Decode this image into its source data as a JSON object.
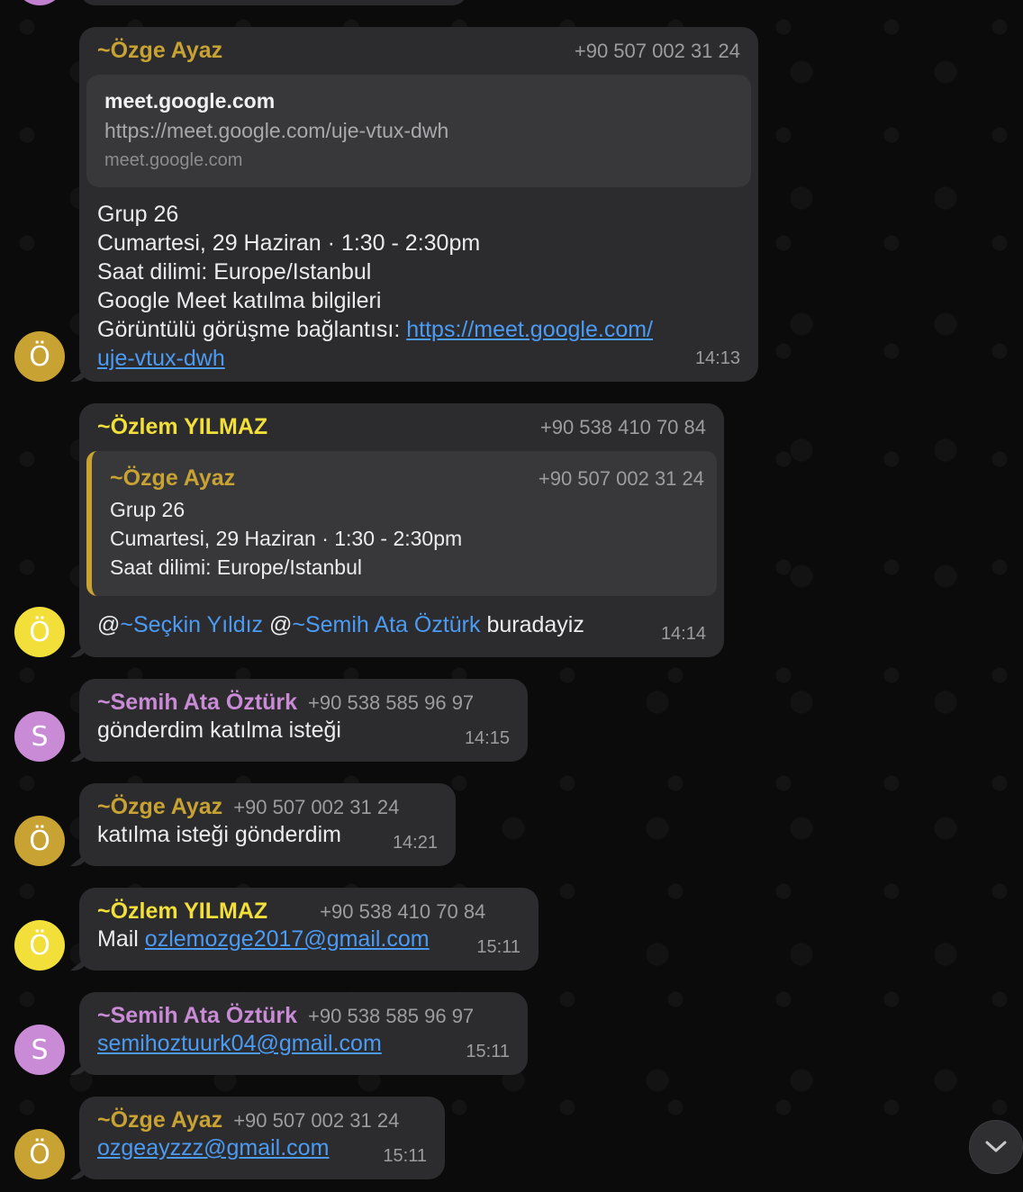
{
  "colors": {
    "ozge": "#c8a232",
    "ozlem": "#f3df3a",
    "semih": "#c98bd6",
    "link": "#4b9bf5",
    "bubble": "#2c2c2e"
  },
  "messages": [
    {
      "avatar": "Ö",
      "sender": "~Özge Ayaz",
      "phone": "+90 507 002 31 24",
      "preview": {
        "site": "meet.google.com",
        "url": "https://meet.google.com/uje-vtux-dwh",
        "domain": "meet.google.com"
      },
      "lines": [
        "Grup 26",
        "Cumartesi, 29 Haziran · 1:30 - 2:30pm",
        "Saat dilimi: Europe/Istanbul",
        "Google Meet katılma bilgileri"
      ],
      "link_prefix": "Görüntülü görüşme bağlantısı: ",
      "link_part1": "https://meet.google.com/",
      "link_part2": "uje-vtux-dwh",
      "time": "14:13"
    },
    {
      "avatar": "Ö",
      "sender": "~Özlem YILMAZ",
      "phone": "+90 538 410 70 84",
      "quote": {
        "sender": "~Özge Ayaz",
        "phone": "+90 507 002 31 24",
        "lines": [
          "Grup 26",
          "Cumartesi, 29 Haziran · 1:30 - 2:30pm",
          "Saat dilimi: Europe/Istanbul"
        ]
      },
      "mention1_at": "@",
      "mention1": "~Seçkin Yıldız",
      "mention2_at": " @",
      "mention2": "~Semih Ata Öztürk",
      "text": " buradayiz",
      "time": "14:14"
    },
    {
      "avatar": "S",
      "sender": "~Semih Ata Öztürk",
      "phone": "+90 538 585 96 97",
      "text": "gönderdim katılma isteği",
      "time": "14:15"
    },
    {
      "avatar": "Ö",
      "sender": "~Özge Ayaz",
      "phone": "+90 507 002 31 24",
      "text": "katılma isteği gönderdim",
      "time": "14:21"
    },
    {
      "avatar": "Ö",
      "sender": "~Özlem YILMAZ",
      "phone": "+90 538 410 70 84",
      "text": "Mail ",
      "email": "ozlemozge2017@gmail.com",
      "time": "15:11"
    },
    {
      "avatar": "S",
      "sender": "~Semih Ata Öztürk",
      "phone": "+90 538 585 96 97",
      "email": "semihoztuurk04@gmail.com",
      "time": "15:11"
    },
    {
      "avatar": "Ö",
      "sender": "~Özge Ayaz",
      "phone": "+90 507 002 31 24",
      "email": "ozgeayzzz@gmail.com",
      "time": "15:11"
    }
  ],
  "scroll_button_icon": "chevron-down-icon"
}
